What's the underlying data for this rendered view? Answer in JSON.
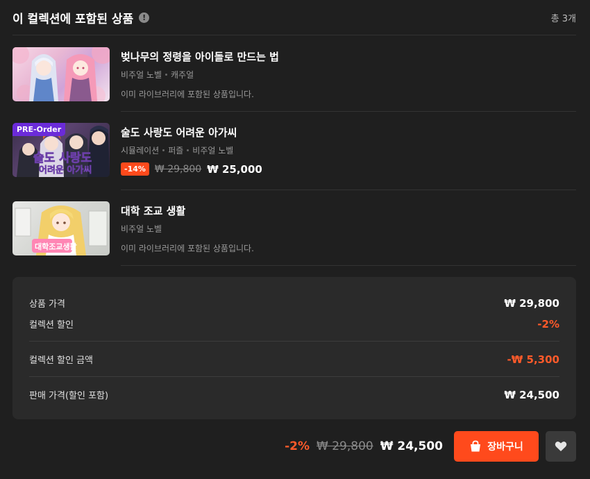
{
  "header": {
    "title": "이 컬렉션에 포함된 상품",
    "info_icon": "!",
    "total": "총 3개"
  },
  "items": [
    {
      "title": "벚나무의 정령을 아이돌로 만드는 법",
      "tags": [
        "비주얼 노벨",
        "캐주얼"
      ],
      "note": "이미 라이브러리에 포함된 상품입니다."
    },
    {
      "badge": "PRE-Order",
      "title": "술도 사랑도 어려운 아가씨",
      "tags": [
        "시뮬레이션",
        "퍼즐",
        "비주얼 노벨"
      ],
      "discount": "-14%",
      "old_price": "₩ 29,800",
      "price": "₩ 25,000",
      "cover_text_1": "술도 사랑도",
      "cover_text_2": "어려운 아가씨"
    },
    {
      "title": "대학 조교 생활",
      "tags": [
        "비주얼 노벨"
      ],
      "note": "이미 라이브러리에 포함된 상품입니다.",
      "cover_text": "대학조교생활"
    }
  ],
  "summary": {
    "product_price_label": "상품 가격",
    "product_price": "₩ 29,800",
    "collection_discount_label": "컬렉션 할인",
    "collection_discount": "-2%",
    "discount_amount_label": "컬렉션 할인 금액",
    "discount_amount": "-₩ 5,300",
    "sale_price_label": "판매 가격(할인 포함)",
    "sale_price": "₩ 24,500"
  },
  "bottom": {
    "discount": "-2%",
    "old_price": "₩ 29,800",
    "final_price": "₩ 24,500",
    "cart_label": "장바구니"
  },
  "colors": {
    "accent": "#ff4a1c",
    "preorder": "#6b2bd9",
    "background": "#1f1f1f",
    "panel": "#2a2a2a"
  },
  "icons": {
    "info": "info-icon",
    "cart": "shopping-bag-icon",
    "wish": "heart-icon"
  }
}
